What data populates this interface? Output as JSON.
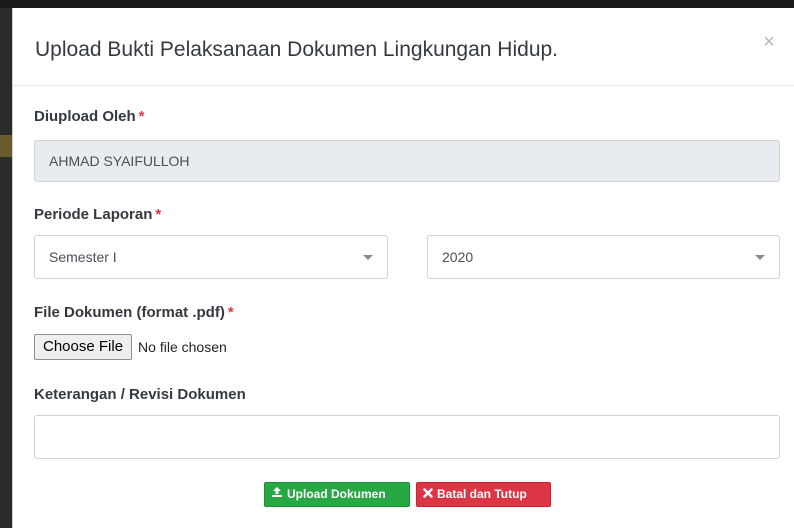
{
  "modal": {
    "title": "Upload Bukti Pelaksanaan Dokumen Lingkungan Hidup.",
    "close_icon": "×"
  },
  "form": {
    "uploaded_by": {
      "label": "Diupload Oleh",
      "required_mark": "*",
      "value": "AHMAD SYAIFULLOH"
    },
    "period": {
      "label": "Periode Laporan",
      "required_mark": "*",
      "semester_selected": "Semester I",
      "year_selected": "2020"
    },
    "file": {
      "label": "File Dokumen (format .pdf)",
      "required_mark": "*",
      "button_label": "Choose File",
      "status": "No file chosen"
    },
    "notes": {
      "label": "Keterangan / Revisi Dokumen",
      "value": ""
    }
  },
  "actions": {
    "upload_label": "Upload Dokumen",
    "upload_icon": "upload-icon",
    "cancel_label": "Batal dan Tutup",
    "cancel_icon": "times-icon"
  },
  "colors": {
    "success": "#28a745",
    "danger": "#dc3545",
    "required": "#dc3545"
  }
}
